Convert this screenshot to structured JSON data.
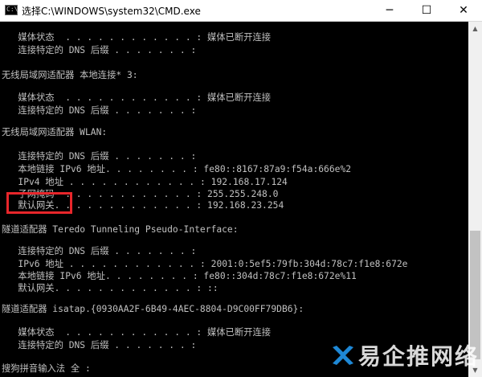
{
  "window": {
    "title": "选择C:\\WINDOWS\\system32\\CMD.exe",
    "icon": "cmd-icon",
    "minimize": "─",
    "maximize": "☐",
    "close": "✕"
  },
  "console": {
    "lines": [
      "   媒体状态  . . . . . . . . . . . . : 媒体已断开连接",
      "   连接特定的 DNS 后缀 . . . . . . . :",
      "",
      "无线局域网适配器 本地连接* 3:",
      "",
      "   媒体状态  . . . . . . . . . . . . : 媒体已断开连接",
      "   连接特定的 DNS 后缀 . . . . . . . :",
      "",
      "无线局域网适配器 WLAN:",
      "",
      "   连接特定的 DNS 后缀 . . . . . . . :",
      "   本地链接 IPv6 地址. . . . . . . . : fe80::8167:87a9:f54a:666e%2",
      "   IPv4 地址 . . . . . . . . . . . . : 192.168.17.124",
      "   子网掩码  . . . . . . . . . . . . : 255.255.248.0",
      "   默认网关. . . . . . . . . . . . . : 192.168.23.254",
      "",
      "隧道适配器 Teredo Tunneling Pseudo-Interface:",
      "",
      "   连接特定的 DNS 后缀 . . . . . . . :",
      "   IPv6 地址 . . . . . . . . . . . . : 2001:0:5ef5:79fb:304d:78c7:f1e8:672e",
      "   本地链接 IPv6 地址. . . . . . . . : fe80::304d:78c7:f1e8:672e%11",
      "   默认网关. . . . . . . . . . . . . : ::",
      "",
      "隧道适配器 isatap.{0930AA2F-6B49-4AEC-8804-D9C00FF79DB6}:",
      "",
      "   媒体状态  . . . . . . . . . . . . : 媒体已断开连接",
      "   连接特定的 DNS 后缀 . . . . . . . :",
      "",
      "搜狗拼音输入法 全 :"
    ],
    "text_color": "#c0c0c0",
    "background_color": "#000000",
    "highlight_color": "#e8262b"
  },
  "watermark": {
    "text": "易企推网络"
  }
}
